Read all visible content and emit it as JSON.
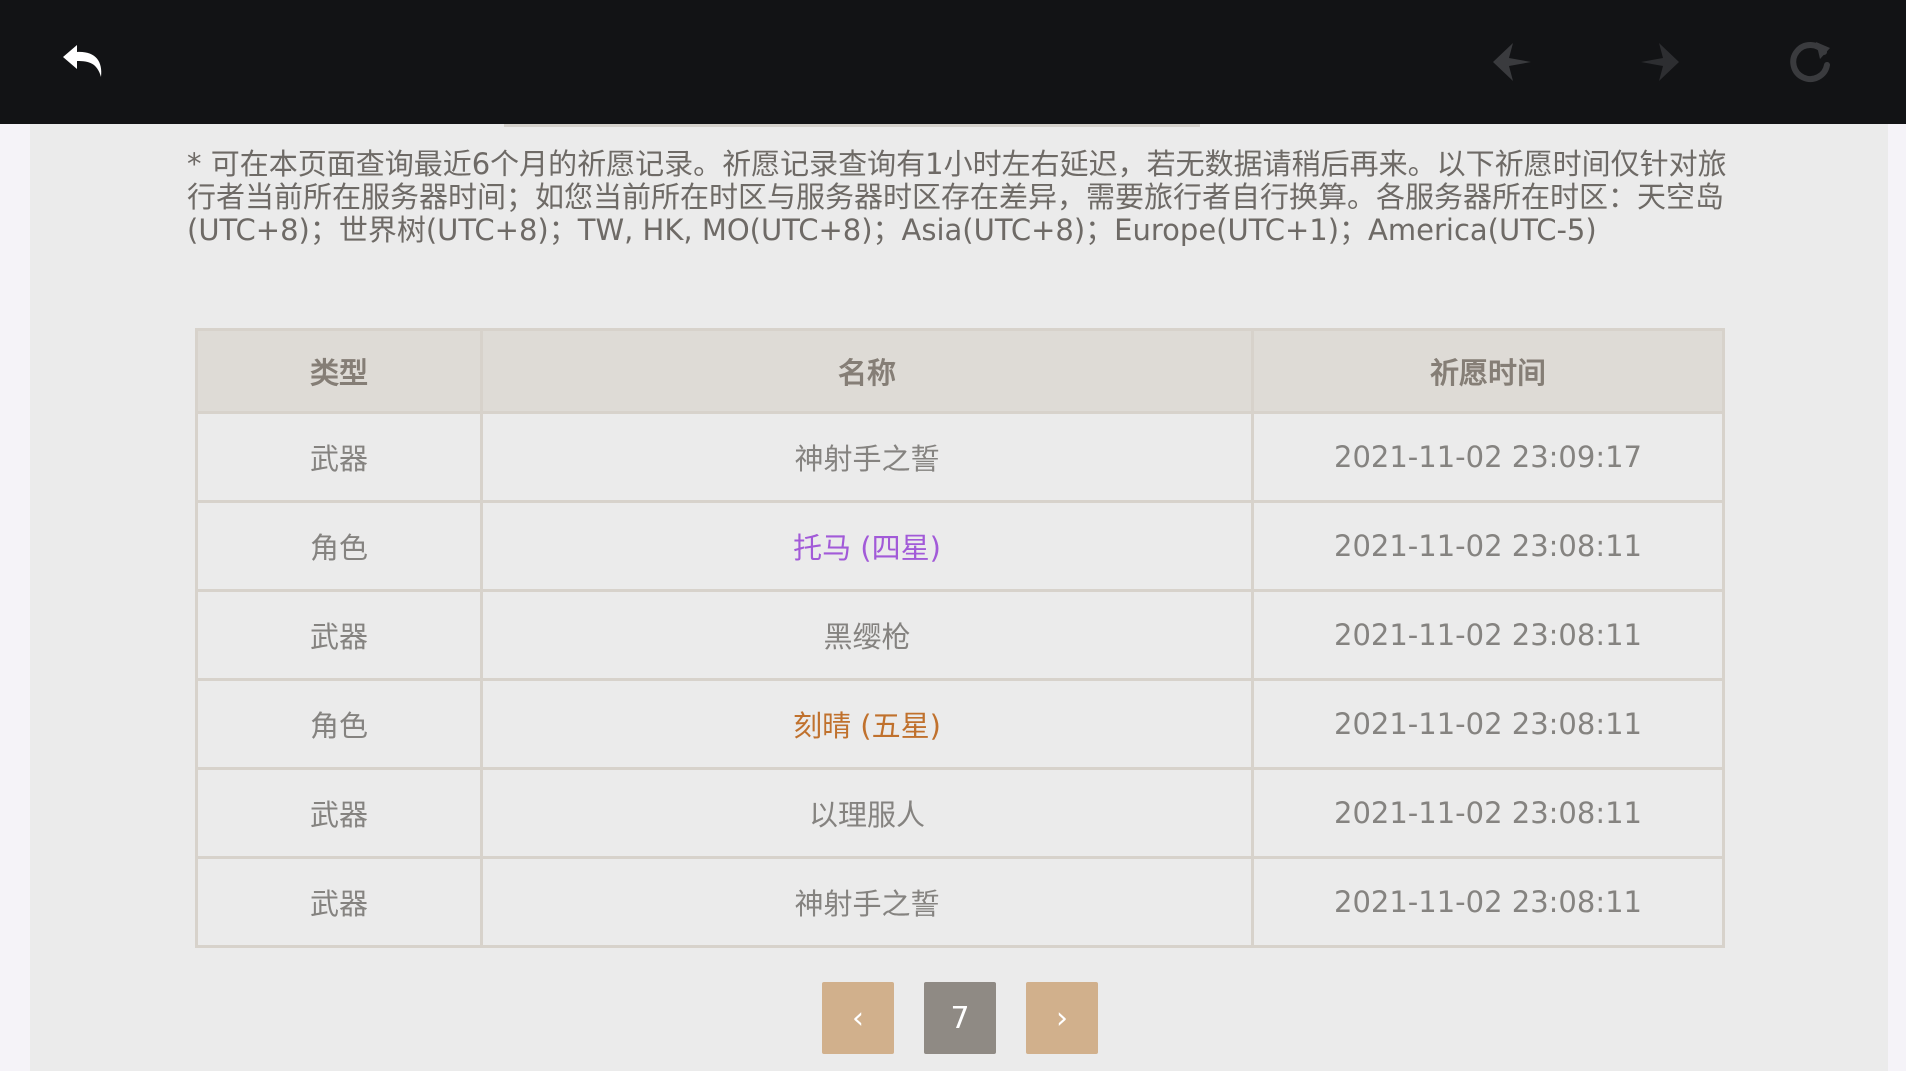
{
  "toolbar": {
    "icons": {
      "back": "back-arrow-icon",
      "prev": "prev-arrow-icon",
      "next": "next-arrow-icon",
      "refresh": "refresh-icon"
    }
  },
  "notice": "* 可在本页面查询最近6个月的祈愿记录。祈愿记录查询有1小时左右延迟，若无数据请稍后再来。以下祈愿时间仅针对旅行者当前所在服务器时间；如您当前所在时区与服务器时区存在差异，需要旅行者自行换算。各服务器所在时区：天空岛(UTC+8)；世界树(UTC+8)；TW, HK, MO(UTC+8)；Asia(UTC+8)；Europe(UTC+1)；America(UTC-5)",
  "table": {
    "headers": [
      "类型",
      "名称",
      "祈愿时间"
    ],
    "rows": [
      {
        "type": "武器",
        "name": "神射手之誓",
        "time": "2021-11-02 23:09:17"
      },
      {
        "type": "角色",
        "name": "托马 (四星)",
        "time": "2021-11-02 23:08:11"
      },
      {
        "type": "武器",
        "name": "黑缨枪",
        "time": "2021-11-02 23:08:11"
      },
      {
        "type": "角色",
        "name": "刻晴 (五星)",
        "time": "2021-11-02 23:08:11"
      },
      {
        "type": "武器",
        "name": "以理服人",
        "time": "2021-11-02 23:08:11"
      },
      {
        "type": "武器",
        "name": "神射手之誓",
        "time": "2021-11-02 23:08:11"
      }
    ]
  },
  "colors": {
    "four_star": "#a25ad8",
    "five_star": "#c0712d",
    "pager_button": "#d1b08c",
    "pager_current": "#8f8a84"
  },
  "pagination": {
    "current_page": "7",
    "prev_label": "‹",
    "next_label": "›"
  }
}
